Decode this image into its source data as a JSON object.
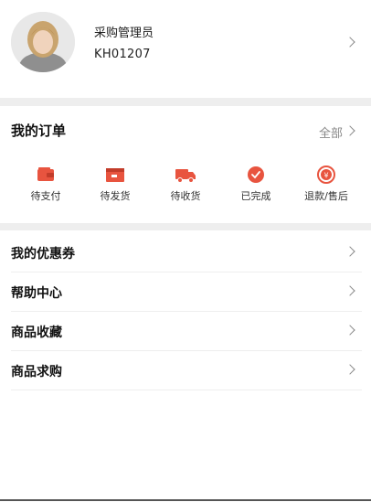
{
  "profile": {
    "role": "采购管理员",
    "account_code": "KH01207"
  },
  "orders": {
    "title": "我的订单",
    "view_all_label": "全部",
    "items": [
      {
        "label": "待支付",
        "icon": "wallet-icon"
      },
      {
        "label": "待发货",
        "icon": "box-icon"
      },
      {
        "label": "待收货",
        "icon": "truck-icon"
      },
      {
        "label": "已完成",
        "icon": "check-circle-icon"
      },
      {
        "label": "退款/售后",
        "icon": "refund-icon"
      }
    ]
  },
  "menu": [
    {
      "label": "我的优惠券"
    },
    {
      "label": "帮助中心"
    },
    {
      "label": "商品收藏"
    },
    {
      "label": "商品求购"
    }
  ],
  "colors": {
    "accent": "#e8543f",
    "divider": "#eeeeee",
    "muted": "#888888"
  }
}
